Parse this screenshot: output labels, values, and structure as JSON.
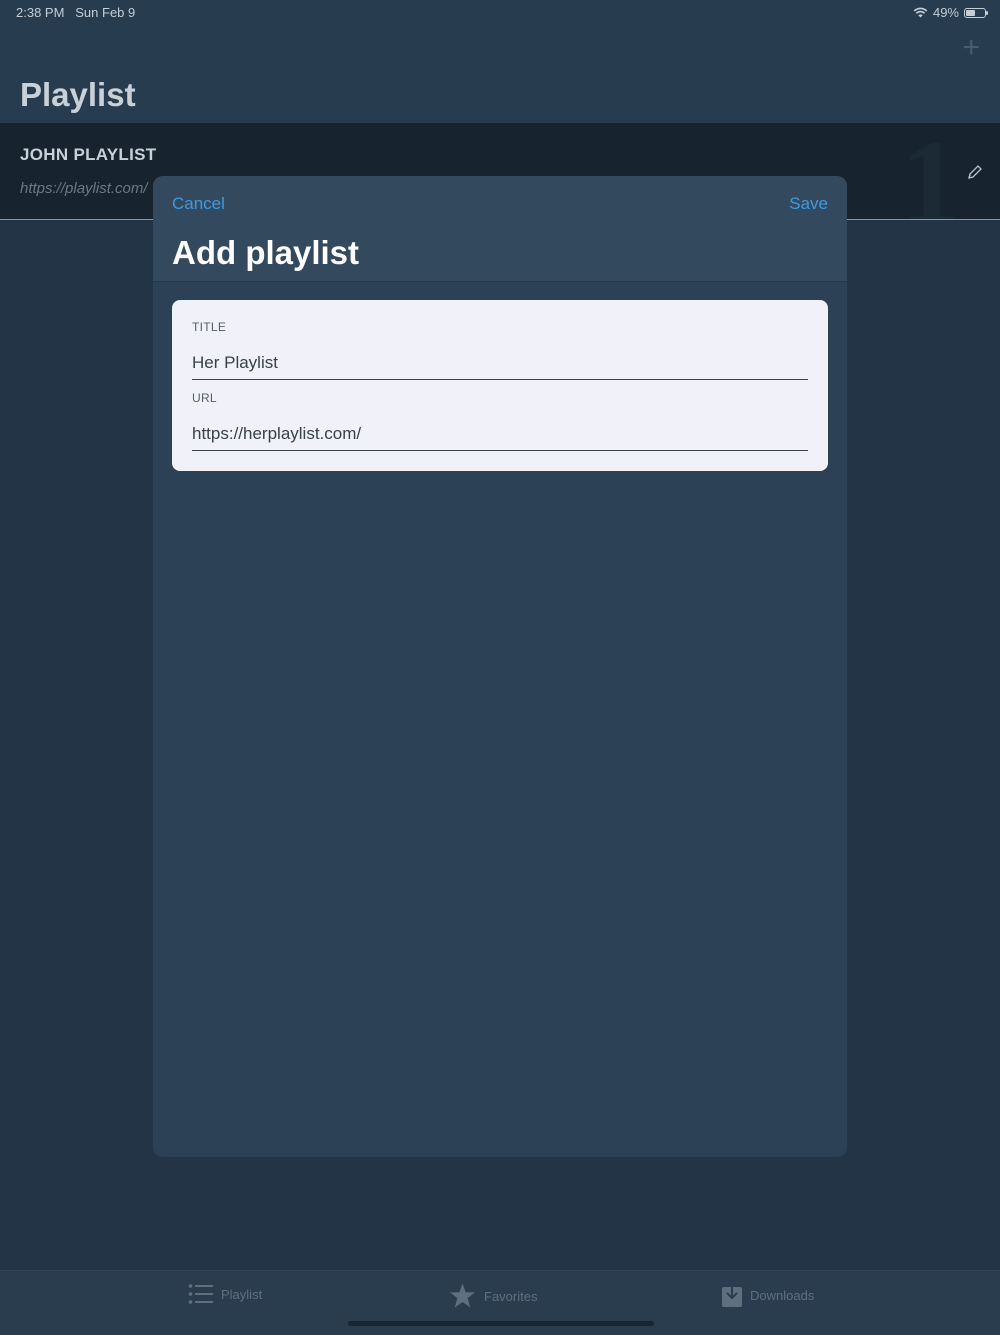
{
  "status": {
    "time": "2:38 PM",
    "date": "Sun Feb 9",
    "battery": "49%"
  },
  "nav": {
    "title": "Playlist"
  },
  "playlist_row": {
    "title": "JOHN PLAYLIST",
    "url": "https://playlist.com/"
  },
  "modal": {
    "cancel_label": "Cancel",
    "save_label": "Save",
    "title": "Add playlist",
    "fields": [
      {
        "label": "TITLE",
        "value": "Her Playlist"
      },
      {
        "label": "URL",
        "value": "https://herplaylist.com/"
      }
    ]
  },
  "tabs": [
    {
      "label": "Playlist",
      "icon": "list-icon"
    },
    {
      "label": "Favorites",
      "icon": "star-icon"
    },
    {
      "label": "Downloads",
      "icon": "download-icon"
    }
  ],
  "colors": {
    "accent": "#3d9be0",
    "sheet": "#2c4155",
    "card": "#f1f2f9"
  }
}
